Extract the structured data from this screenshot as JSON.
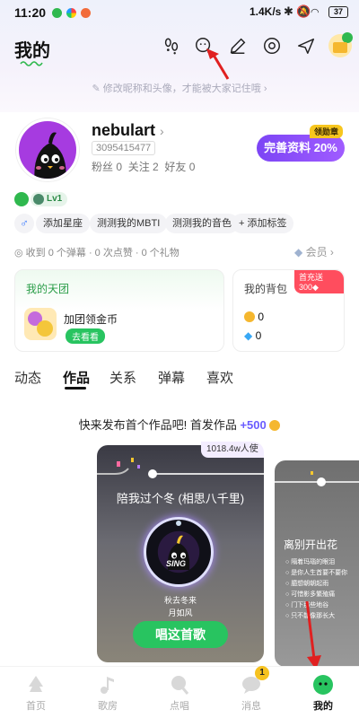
{
  "status_bar": {
    "time": "11:20",
    "net_speed": "1.4K/s",
    "battery": "37"
  },
  "header": {
    "title": "我的",
    "notice": "修改昵称和头像，才能被大家记住哦 ›"
  },
  "profile": {
    "username": "nebulart",
    "uid": "3095415477",
    "fans_label": "粉丝 0",
    "follow_label": "关注 2",
    "friends_label": "好友 0",
    "complete_button": "完善资料 20%",
    "medal_tag": "领勋章",
    "level": "Lv1"
  },
  "tags": [
    "添加星座",
    "测测我的MBTI",
    "测测我的音色",
    "+ 添加标签"
  ],
  "stats_line": "收到 0 个弹幕 · 0 次点赞 · 0 个礼物",
  "member_label": "会员 ›",
  "cards": {
    "tuan_title": "我的天团",
    "tuan_action": "加团领金币",
    "tuan_button": "去看看",
    "bag_title": "我的背包",
    "bag_promo": "首充送300",
    "coins": "0",
    "diamonds": "0"
  },
  "tabs": [
    "动态",
    "作品",
    "关系",
    "弹幕",
    "喜欢"
  ],
  "active_tab": "作品",
  "publish_hint": {
    "text": "快来发布首个作品吧! 首发作品 ",
    "reward": "+500"
  },
  "song_card": {
    "listen_count": "1018.4w人使",
    "title": "陪我过个冬 (相思八千里)",
    "lyric_1": "秋去冬来",
    "lyric_2": "月如风",
    "sing_button": "唱这首歌",
    "disc_label": "SING"
  },
  "song_card_2": {
    "title": "离别开出花",
    "items": [
      "隔着玛瑙的眼泪",
      "是你人生首要不要你",
      "臆想朝朝起雨",
      "可惜影多繁殖痛",
      "门下那些地谷",
      "只不能像那长大"
    ]
  },
  "bottom_nav": {
    "items": [
      "首页",
      "歌房",
      "点唱",
      "消息",
      "我的"
    ],
    "active": "我的",
    "message_badge": "1"
  },
  "colors": {
    "accent_purple": "#7c45f5",
    "green": "#28c460",
    "arrow_red": "#e02020"
  }
}
